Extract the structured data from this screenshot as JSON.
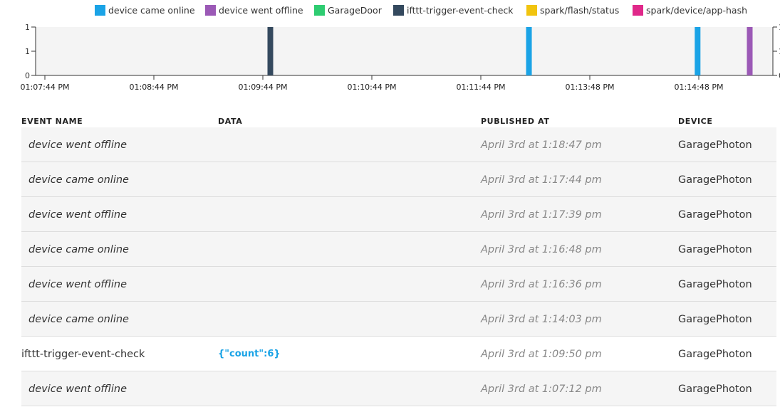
{
  "legend": [
    {
      "label": "device came online",
      "color": "#1aa3e6"
    },
    {
      "label": "device went offline",
      "color": "#9b59b6"
    },
    {
      "label": "GarageDoor",
      "color": "#2ecc71"
    },
    {
      "label": "ifttt-trigger-event-check",
      "color": "#34495e"
    },
    {
      "label": "spark/flash/status",
      "color": "#f1c40f"
    },
    {
      "label": "spark/device/app-hash",
      "color": "#e0288a"
    }
  ],
  "chart_data": {
    "type": "bar",
    "x_ticks": [
      "01:07:44 PM",
      "01:08:44 PM",
      "01:09:44 PM",
      "01:10:44 PM",
      "01:11:44 PM",
      "01:13:48 PM",
      "01:14:48 PM"
    ],
    "y_ticks_left": [
      "0",
      "1",
      "1"
    ],
    "y_ticks_right": [
      "0",
      "1",
      "1"
    ],
    "ylim": [
      0,
      1
    ],
    "grid": false,
    "events": [
      {
        "series": "ifttt-trigger-event-check",
        "time": "01:09:50 PM",
        "value": 1
      },
      {
        "series": "device came online",
        "time": "01:14:03 PM",
        "value": 1
      },
      {
        "series": "device came online",
        "time": "01:16:48 PM",
        "value": 1
      },
      {
        "series": "device went offline",
        "time": "01:17:39 PM",
        "value": 1
      }
    ]
  },
  "table": {
    "headers": {
      "name": "EVENT NAME",
      "data": "DATA",
      "published": "PUBLISHED AT",
      "device": "DEVICE"
    },
    "rows": [
      {
        "name": "device went offline",
        "data": "",
        "published": "April 3rd at 1:18:47 pm",
        "device": "GaragePhoton",
        "italic": true
      },
      {
        "name": "device came online",
        "data": "",
        "published": "April 3rd at 1:17:44 pm",
        "device": "GaragePhoton",
        "italic": true
      },
      {
        "name": "device went offline",
        "data": "",
        "published": "April 3rd at 1:17:39 pm",
        "device": "GaragePhoton",
        "italic": true
      },
      {
        "name": "device came online",
        "data": "",
        "published": "April 3rd at 1:16:48 pm",
        "device": "GaragePhoton",
        "italic": true
      },
      {
        "name": "device went offline",
        "data": "",
        "published": "April 3rd at 1:16:36 pm",
        "device": "GaragePhoton",
        "italic": true
      },
      {
        "name": "device came online",
        "data": "",
        "published": "April 3rd at 1:14:03 pm",
        "device": "GaragePhoton",
        "italic": true
      },
      {
        "name": "ifttt-trigger-event-check",
        "data": "{\"count\":6}",
        "published": "April 3rd at 1:09:50 pm",
        "device": "GaragePhoton",
        "italic": false
      },
      {
        "name": "device went offline",
        "data": "",
        "published": "April 3rd at 1:07:12 pm",
        "device": "GaragePhoton",
        "italic": true
      }
    ]
  }
}
